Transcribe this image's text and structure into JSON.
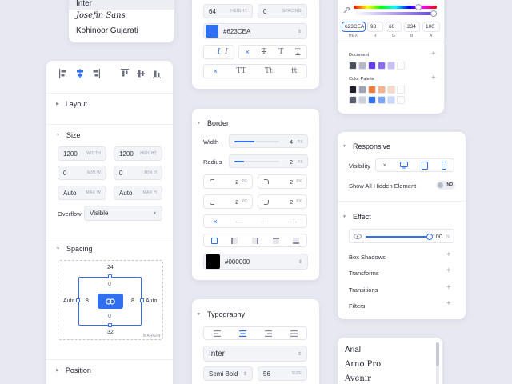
{
  "fonts_top": {
    "items": [
      "Inter",
      "Josefin Sans",
      "Kohinoor Gujarati"
    ]
  },
  "layout_panel": {
    "sections": {
      "layout": "Layout",
      "size": "Size",
      "spacing": "Spacing",
      "position": "Position"
    },
    "size": {
      "width": {
        "value": "1200",
        "unit": "WIDTH"
      },
      "height": {
        "value": "1200",
        "unit": "HEIGHT"
      },
      "min_w": {
        "value": "0",
        "unit": "MIN W"
      },
      "min_h": {
        "value": "0",
        "unit": "MIN H"
      },
      "max_w": {
        "value": "Auto",
        "unit": "MAX W"
      },
      "max_h": {
        "value": "Auto",
        "unit": "MAX H"
      },
      "overflow_label": "Overflow",
      "overflow_value": "Visible"
    },
    "spacing": {
      "margin_top": "24",
      "margin_bottom": "32",
      "margin_left": "Auto",
      "margin_right": "Auto",
      "padding_top": "0",
      "padding_bottom": "0",
      "padding_left": "8",
      "padding_right": "8",
      "margin_label": "MARGIN"
    }
  },
  "text_style_panel": {
    "height": {
      "value": "64",
      "unit": "HEIGHT"
    },
    "spacing": {
      "value": "0",
      "unit": "SPACING"
    },
    "color_hex": "#623CEA",
    "style_buttons": [
      "I",
      "I",
      "×",
      "T",
      "T",
      "T"
    ],
    "case_buttons": [
      "×",
      "TT",
      "Tt",
      "tt"
    ]
  },
  "border_panel": {
    "title": "Border",
    "width": {
      "label": "Width",
      "value": "4",
      "unit": "PX",
      "fraction": 0.45
    },
    "radius": {
      "label": "Radius",
      "value": "2",
      "unit": "PX",
      "fraction": 0.22
    },
    "corners": [
      {
        "value": "2",
        "unit": "PX"
      },
      {
        "value": "2",
        "unit": "PX"
      },
      {
        "value": "2",
        "unit": "PX"
      },
      {
        "value": "2",
        "unit": "PX"
      }
    ],
    "line_styles": [
      "×",
      "—",
      "---",
      "····"
    ],
    "color_hex": "#000000"
  },
  "typography_panel": {
    "title": "Typography",
    "font_family": "Inter",
    "font_weight": "Semi Bold",
    "font_size": {
      "value": "56",
      "unit": "SIZE"
    }
  },
  "color_panel": {
    "hex": "623CEA",
    "r": "98",
    "g": "60",
    "b": "234",
    "a": "100",
    "labels": {
      "hex": "HEX",
      "r": "R",
      "g": "G",
      "b": "B",
      "a": "A"
    },
    "document_label": "Document",
    "document_colors": [
      "#4a4f5e",
      "#b5b9c6",
      "#623cea",
      "#8b6cf0",
      "#c9bef8",
      "#ffffff"
    ],
    "palette_label": "Color Palette",
    "palette_rows": [
      [
        "#1d1f27",
        "#9fa4b2",
        "#f07a35",
        "#f5b38b",
        "#fbd9c4",
        "#ffffff"
      ],
      [
        "#5b5f6d",
        "#cdd0d8",
        "#2f6ff0",
        "#7aa5f5",
        "#c6d8fb",
        "#ffffff"
      ]
    ],
    "hue_fraction": 0.78,
    "alpha_fraction": 1.0
  },
  "responsive_panel": {
    "title": "Responsive",
    "visibility_label": "Visibility",
    "show_hidden_label": "Show All Hidden Element",
    "toggle_text": "NO"
  },
  "effect_panel": {
    "title": "Effect",
    "opacity": {
      "value": "100",
      "unit": "%",
      "fraction": 1.0
    },
    "items": [
      "Box Shadows",
      "Transforms",
      "Transitions",
      "Filters"
    ]
  },
  "font_list_panel": {
    "items": [
      "Arial",
      "Arno Pro",
      "Avenir"
    ]
  }
}
